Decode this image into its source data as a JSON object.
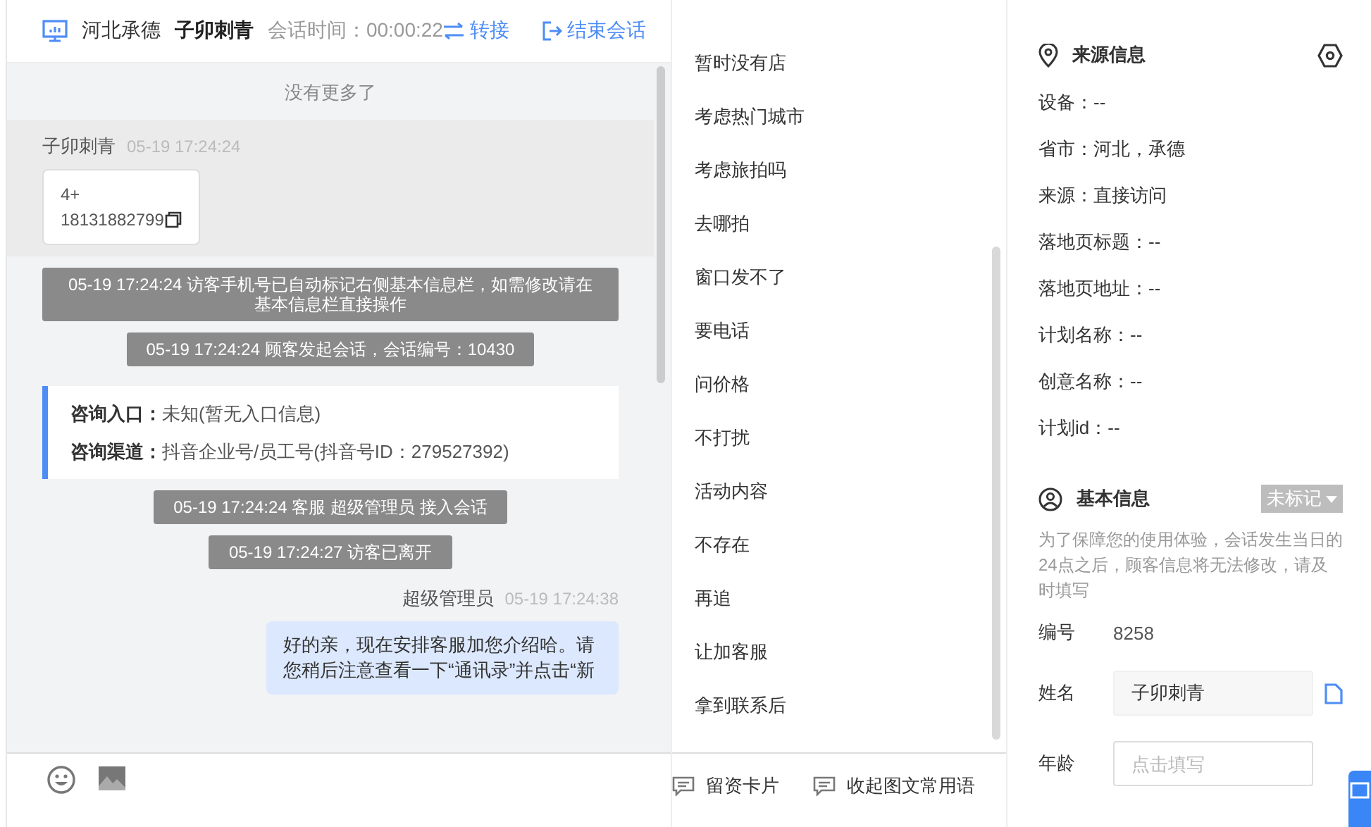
{
  "chat_header": {
    "location": "河北承德",
    "visitor": "子卯刺青",
    "duration_label": "会话时间：00:00:22",
    "transfer": "转接",
    "end_session": "结束会话"
  },
  "messages": [
    {
      "kind": "notice",
      "text": "没有更多了"
    },
    {
      "kind": "visitor",
      "sender": "子卯刺青",
      "time": "05-19 17:24:24",
      "lines": [
        "4+",
        "18131882799"
      ]
    },
    {
      "kind": "system",
      "text": "05-19 17:24:24 访客手机号已自动标记右侧基本信息栏，如需修改请在基本信息栏直接操作"
    },
    {
      "kind": "system",
      "text": "05-19 17:24:24 顾客发起会话，会话编号：10430"
    },
    {
      "kind": "consult",
      "fields": [
        {
          "label": "咨询入口：",
          "value": "未知(暂无入口信息)"
        },
        {
          "label": "咨询渠道：",
          "value": "抖音企业号/员工号(抖音号ID：279527392)"
        }
      ]
    },
    {
      "kind": "system",
      "text": "05-19 17:24:24 客服 超级管理员 接入会话"
    },
    {
      "kind": "system",
      "text": "05-19 17:24:27 访客已离开"
    },
    {
      "kind": "agent",
      "sender": "超级管理员",
      "time": "05-19 17:24:38",
      "text": "好的亲，现在安排客服加您介绍哈。请您稍后注意查看一下“通讯录”并点击“新"
    }
  ],
  "quick_replies": [
    "暂时没有店",
    "考虑热门城市",
    "考虑旅拍吗",
    "去哪拍",
    "窗口发不了",
    "要电话",
    "问价格",
    "不打扰",
    "活动内容",
    "不存在",
    "再追",
    "让加客服",
    "拿到联系后"
  ],
  "reply_footer": [
    "留资卡片",
    "收起图文常用语"
  ],
  "source_info": {
    "title": "来源信息",
    "fields": [
      "设备：--",
      "省市：河北，承德",
      "来源：直接访问",
      "落地页标题：--",
      "落地页地址：--",
      "计划名称：--",
      "创意名称：--",
      "计划id：--"
    ]
  },
  "basic_info": {
    "title": "基本信息",
    "tag": "未标记",
    "note": "为了保障您的使用体验，会话发生当日的24点之后，顾客信息将无法修改，请及时填写",
    "id_label": "编号",
    "id_value": "8258",
    "name_label": "姓名",
    "name_value": "子卯刺青",
    "age_label": "年龄",
    "age_placeholder": "点击填写"
  }
}
